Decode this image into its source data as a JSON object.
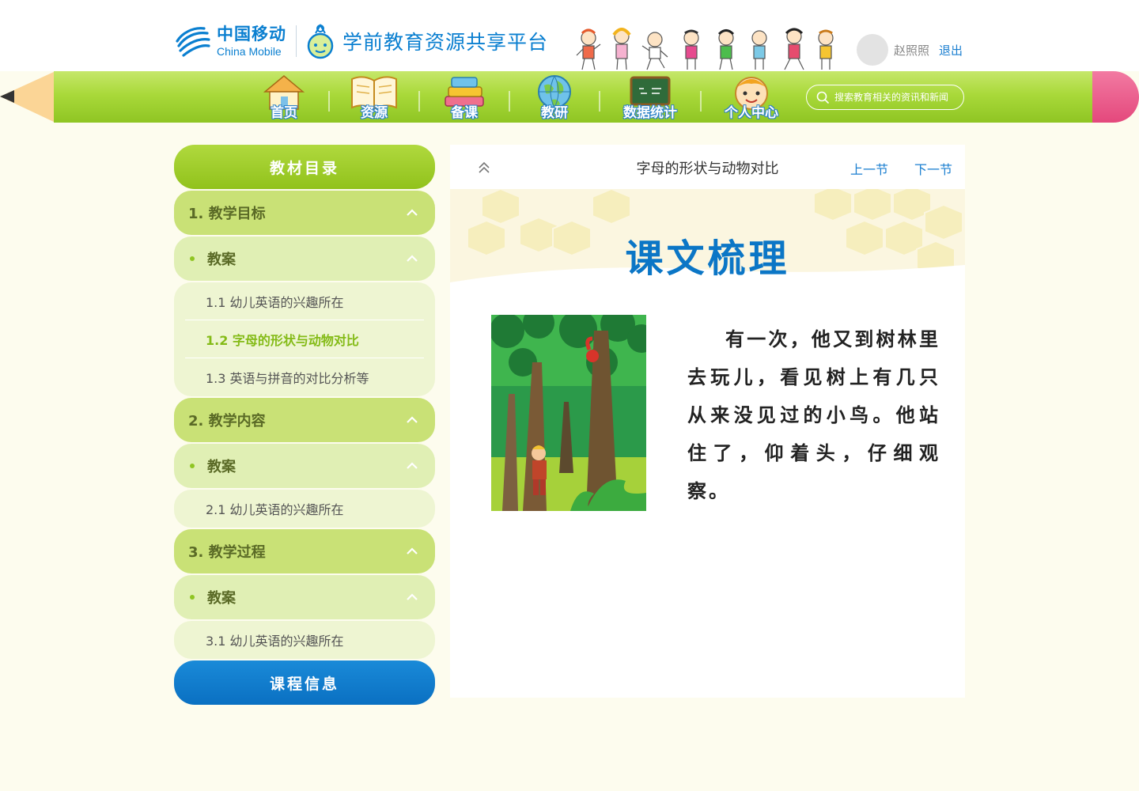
{
  "header": {
    "brand_cn": "中国移动",
    "brand_en": "China Mobile",
    "platform_name": "学前教育资源共享平台",
    "user_name": "赵照照",
    "logout_label": "退出"
  },
  "nav": {
    "items": [
      {
        "label": "首页",
        "icon": "house-icon"
      },
      {
        "label": "资源",
        "icon": "book-icon"
      },
      {
        "label": "备课",
        "icon": "books-stack-icon"
      },
      {
        "label": "教研",
        "icon": "globe-icon"
      },
      {
        "label": "数据统计",
        "icon": "blackboard-icon"
      },
      {
        "label": "个人中心",
        "icon": "child-face-icon"
      }
    ],
    "search_placeholder": "搜索教育相关的资讯和新闻"
  },
  "sidebar": {
    "title": "教材目录",
    "sections": [
      {
        "label": "1. 教学目标",
        "sub_label": "教案",
        "items": [
          "1.1  幼儿英语的兴趣所在",
          "1.2  字母的形状与动物对比",
          "1.3  英语与拼音的对比分析等"
        ],
        "active_index": 1
      },
      {
        "label": "2. 教学内容",
        "sub_label": "教案",
        "items": [
          "2.1  幼儿英语的兴趣所在"
        ]
      },
      {
        "label": "3. 教学过程",
        "sub_label": "教案",
        "items": [
          "3.1  幼儿英语的兴趣所在"
        ]
      }
    ],
    "info_button": "课程信息"
  },
  "content": {
    "lesson_title": "字母的形状与动物对比",
    "prev_label": "上一节",
    "next_label": "下一节",
    "banner_title": "课文梳理",
    "story_text": "有一次，他又到树林里去玩儿，看见树上有几只从来没见过的小鸟。他站住了，仰着头，仔细观察。"
  },
  "colors": {
    "green_accent": "#8fc523",
    "blue_accent": "#0a7fd0",
    "eraser_pink": "#e4487c",
    "page_bg": "#fdfcee"
  }
}
